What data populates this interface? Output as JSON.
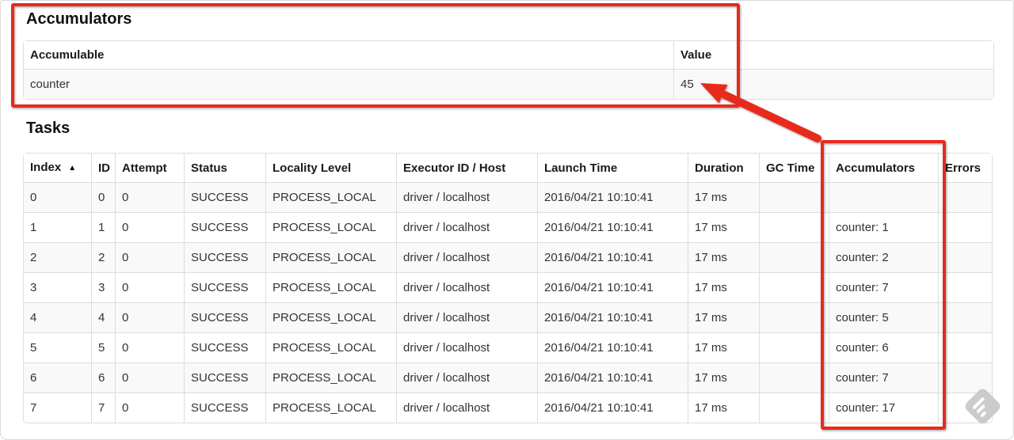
{
  "accumulators": {
    "title": "Accumulators",
    "headers": {
      "accumulable": "Accumulable",
      "value": "Value"
    },
    "rows": [
      {
        "accumulable": "counter",
        "value": "45"
      }
    ]
  },
  "tasks": {
    "title": "Tasks",
    "sort_icon": "▲",
    "headers": {
      "index": "Index",
      "id": "ID",
      "attempt": "Attempt",
      "status": "Status",
      "locality": "Locality Level",
      "executor": "Executor ID / Host",
      "launch": "Launch Time",
      "duration": "Duration",
      "gc": "GC Time",
      "accumulators": "Accumulators",
      "errors": "Errors"
    },
    "rows": [
      {
        "index": "0",
        "id": "0",
        "attempt": "0",
        "status": "SUCCESS",
        "locality": "PROCESS_LOCAL",
        "executor": "driver / localhost",
        "launch": "2016/04/21 10:10:41",
        "duration": "17 ms",
        "gc": "",
        "accumulators": "",
        "errors": ""
      },
      {
        "index": "1",
        "id": "1",
        "attempt": "0",
        "status": "SUCCESS",
        "locality": "PROCESS_LOCAL",
        "executor": "driver / localhost",
        "launch": "2016/04/21 10:10:41",
        "duration": "17 ms",
        "gc": "",
        "accumulators": "counter: 1",
        "errors": ""
      },
      {
        "index": "2",
        "id": "2",
        "attempt": "0",
        "status": "SUCCESS",
        "locality": "PROCESS_LOCAL",
        "executor": "driver / localhost",
        "launch": "2016/04/21 10:10:41",
        "duration": "17 ms",
        "gc": "",
        "accumulators": "counter: 2",
        "errors": ""
      },
      {
        "index": "3",
        "id": "3",
        "attempt": "0",
        "status": "SUCCESS",
        "locality": "PROCESS_LOCAL",
        "executor": "driver / localhost",
        "launch": "2016/04/21 10:10:41",
        "duration": "17 ms",
        "gc": "",
        "accumulators": "counter: 7",
        "errors": ""
      },
      {
        "index": "4",
        "id": "4",
        "attempt": "0",
        "status": "SUCCESS",
        "locality": "PROCESS_LOCAL",
        "executor": "driver / localhost",
        "launch": "2016/04/21 10:10:41",
        "duration": "17 ms",
        "gc": "",
        "accumulators": "counter: 5",
        "errors": ""
      },
      {
        "index": "5",
        "id": "5",
        "attempt": "0",
        "status": "SUCCESS",
        "locality": "PROCESS_LOCAL",
        "executor": "driver / localhost",
        "launch": "2016/04/21 10:10:41",
        "duration": "17 ms",
        "gc": "",
        "accumulators": "counter: 6",
        "errors": ""
      },
      {
        "index": "6",
        "id": "6",
        "attempt": "0",
        "status": "SUCCESS",
        "locality": "PROCESS_LOCAL",
        "executor": "driver / localhost",
        "launch": "2016/04/21 10:10:41",
        "duration": "17 ms",
        "gc": "",
        "accumulators": "counter: 7",
        "errors": ""
      },
      {
        "index": "7",
        "id": "7",
        "attempt": "0",
        "status": "SUCCESS",
        "locality": "PROCESS_LOCAL",
        "executor": "driver / localhost",
        "launch": "2016/04/21 10:10:41",
        "duration": "17 ms",
        "gc": "",
        "accumulators": "counter: 17",
        "errors": ""
      }
    ]
  },
  "annotations": {
    "color": "#e8291c"
  },
  "watermark": {
    "icon": "feedly-logo"
  }
}
